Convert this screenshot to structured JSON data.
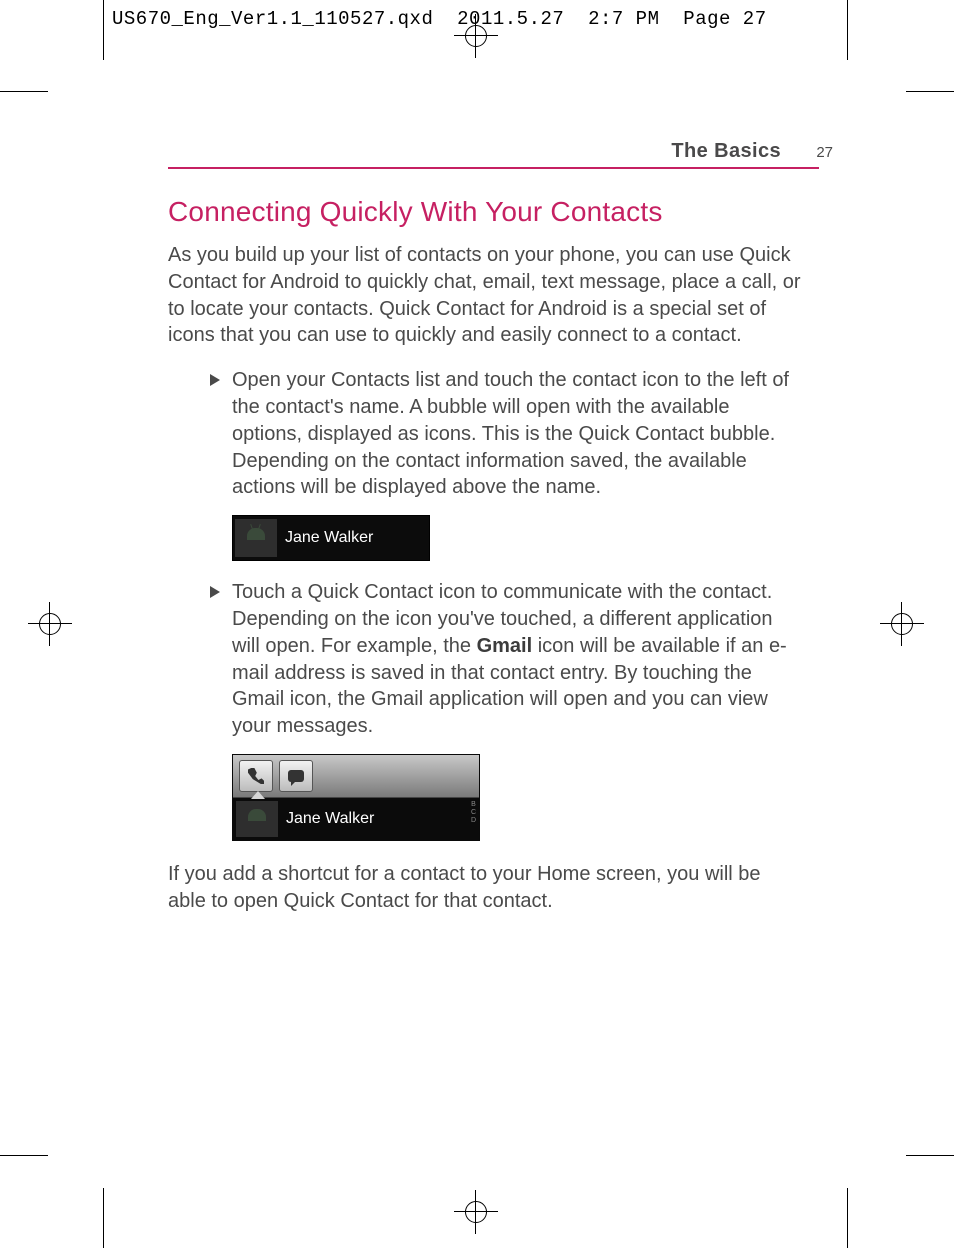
{
  "slug": "US670_Eng_Ver1.1_110527.qxd  2011.5.27  2:7 PM  Page 27",
  "running_head": {
    "label": "The Basics",
    "page": "27"
  },
  "heading": "Connecting Quickly With Your Contacts",
  "intro": "As you build up your list of contacts on your phone, you can use Quick Contact for Android to quickly chat, email, text message, place a call, or to locate your contacts. Quick Contact for Android is a special set of icons that you can use to quickly and easily connect to a contact.",
  "bullet1": "Open your Contacts list and touch the contact icon to the left of the contact's name. A bubble will open with the available options, displayed as icons. This is the Quick Contact bubble. Depending on the contact information saved, the available actions will be displayed above the name.",
  "bullet2a": "Touch a Quick Contact icon to communicate with the contact.",
  "bullet2b_pre": "Depending on the icon you've touched, a different application will open. For example, the ",
  "bullet2b_bold": "Gmail",
  "bullet2b_post": " icon will be available if an e-mail address is saved in that contact entry. By touching the Gmail icon, the Gmail application will open and you can view your messages.",
  "chip_name": "Jane Walker",
  "chip2_letters": "B\nC\nD",
  "outro": "If you add a shortcut for a contact to your Home screen, you will be able to open Quick Contact for that contact."
}
